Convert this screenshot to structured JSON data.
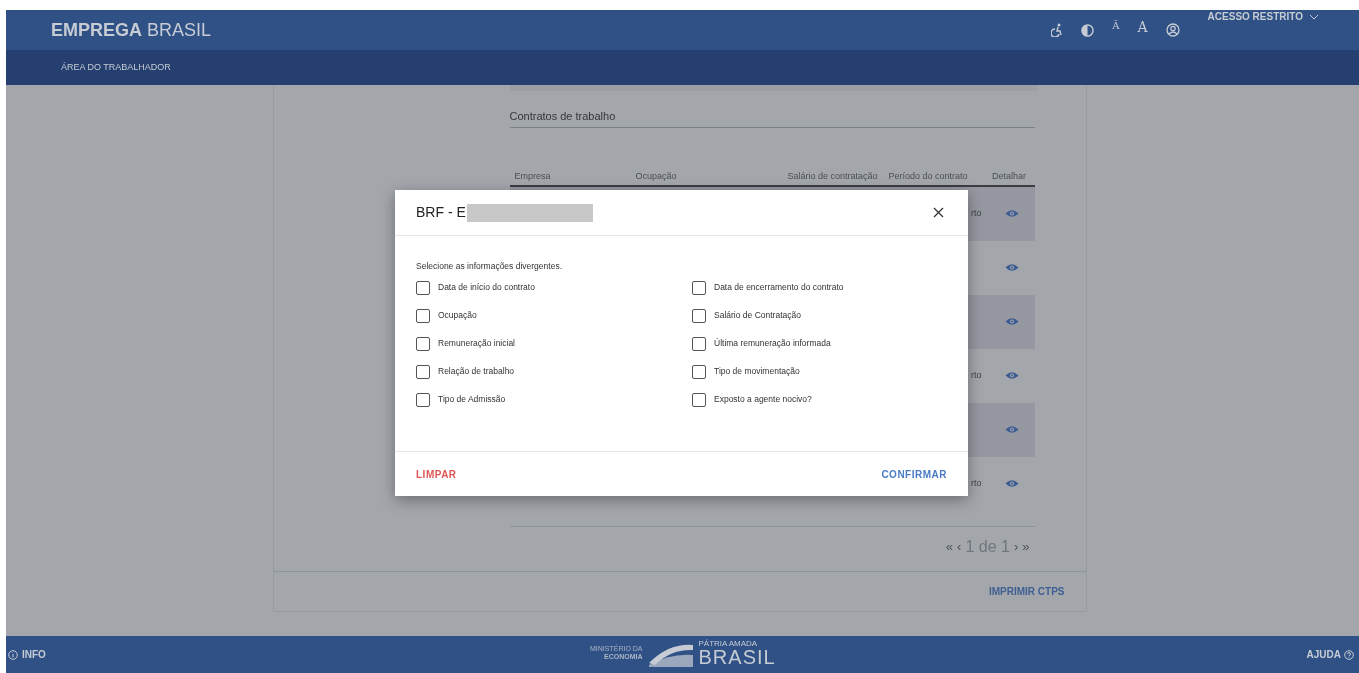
{
  "header": {
    "brand_bold": "EMPREGA",
    "brand_light": "BRASIL",
    "font_buttons": [
      "Ā",
      "A"
    ],
    "restricted_access": "ACESSO RESTRITO"
  },
  "nav": {
    "items": [
      {
        "label": "ÁREA DO TRABALHADOR",
        "selected": true
      }
    ]
  },
  "contracts": {
    "title": "Contratos de trabalho",
    "columns": [
      "Empresa",
      "Ocupação",
      "Salário de contratação",
      "Período do contrato",
      "Detalhar"
    ],
    "rows": [
      {
        "shaded": true,
        "period": "rto"
      },
      {
        "shaded": false
      },
      {
        "shaded": true
      },
      {
        "shaded": false,
        "period": "rto"
      },
      {
        "shaded": true
      },
      {
        "shaded": false,
        "period": "rto"
      }
    ],
    "pagination": {
      "first": "«",
      "prev": "‹",
      "page": "1 de 1",
      "next": "›",
      "last": "»"
    },
    "print_button": "IMPRIMIR CTPS"
  },
  "modal": {
    "title": "BRF - E",
    "instruction": "Selecione as informações divergentes.",
    "options": [
      {
        "label": "Data de início do contrato",
        "checked": false
      },
      {
        "label": "Data de encerramento do contrato",
        "checked": false
      },
      {
        "label": "Ocupação",
        "checked": false
      },
      {
        "label": "Salário de Contratação",
        "checked": false
      },
      {
        "label": "Remuneração inicial",
        "checked": false
      },
      {
        "label": "Última remuneração informada",
        "checked": false
      },
      {
        "label": "Relação de trabalho",
        "checked": false
      },
      {
        "label": "Tipo de movimentação",
        "checked": false
      },
      {
        "label": "Tipo de Admissão",
        "checked": false
      },
      {
        "label": "Exposto a agente nocivo?",
        "checked": false
      }
    ],
    "clear_button": "LIMPAR",
    "confirm_button": "CONFIRMAR"
  },
  "footer": {
    "info": "INFO",
    "ministry_line1": "MINISTÉRIO DA",
    "ministry_line2": "ECONOMIA",
    "slogan": "PÁTRIA AMADA",
    "country": "BRASIL",
    "help": "AJUDA"
  }
}
